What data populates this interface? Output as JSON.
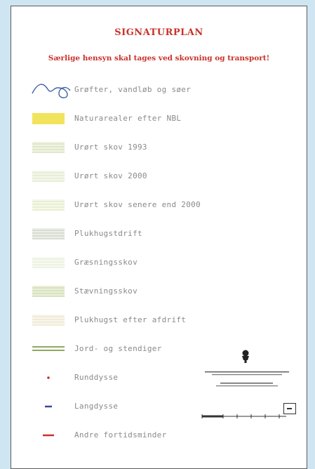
{
  "title": "SIGNATURPLAN",
  "subtitle": "Særlige hensyn skal tages ved skovning og transport!",
  "legend": [
    {
      "label": "Grøfter, vandløb og søer",
      "symbol": "waterway-line-icon"
    },
    {
      "label": "Naturarealer efter NBL",
      "symbol": "yellow-area-swatch"
    },
    {
      "label": "Urørt skov 1993",
      "symbol": "hatched-area-swatch"
    },
    {
      "label": "Urørt skov 2000",
      "symbol": "hatched-area-swatch"
    },
    {
      "label": "Urørt skov senere end 2000",
      "symbol": "hatched-area-swatch"
    },
    {
      "label": "Plukhugstdrift",
      "symbol": "hatched-area-swatch"
    },
    {
      "label": "Græsningsskov",
      "symbol": "hatched-area-swatch"
    },
    {
      "label": "Stævningsskov",
      "symbol": "hatched-area-swatch"
    },
    {
      "label": "Plukhugst efter afdrift",
      "symbol": "hatched-area-swatch"
    },
    {
      "label": "Jord- og stendiger",
      "symbol": "double-line-icon"
    },
    {
      "label": "Runddysse",
      "symbol": "red-dot-icon"
    },
    {
      "label": "Langdysse",
      "symbol": "blue-dash-icon"
    },
    {
      "label": "Andre fortidsminder",
      "symbol": "red-dash-icon"
    }
  ],
  "colors": {
    "title": "#c8322a",
    "label": "#8a8a8a",
    "water": "#3b5fa6",
    "nbl_area": "#f2e35c",
    "dike": "#6f8a2e",
    "runddysse": "#c8322a",
    "langdysse": "#3a46a0",
    "fortidsminder": "#c8322a"
  }
}
